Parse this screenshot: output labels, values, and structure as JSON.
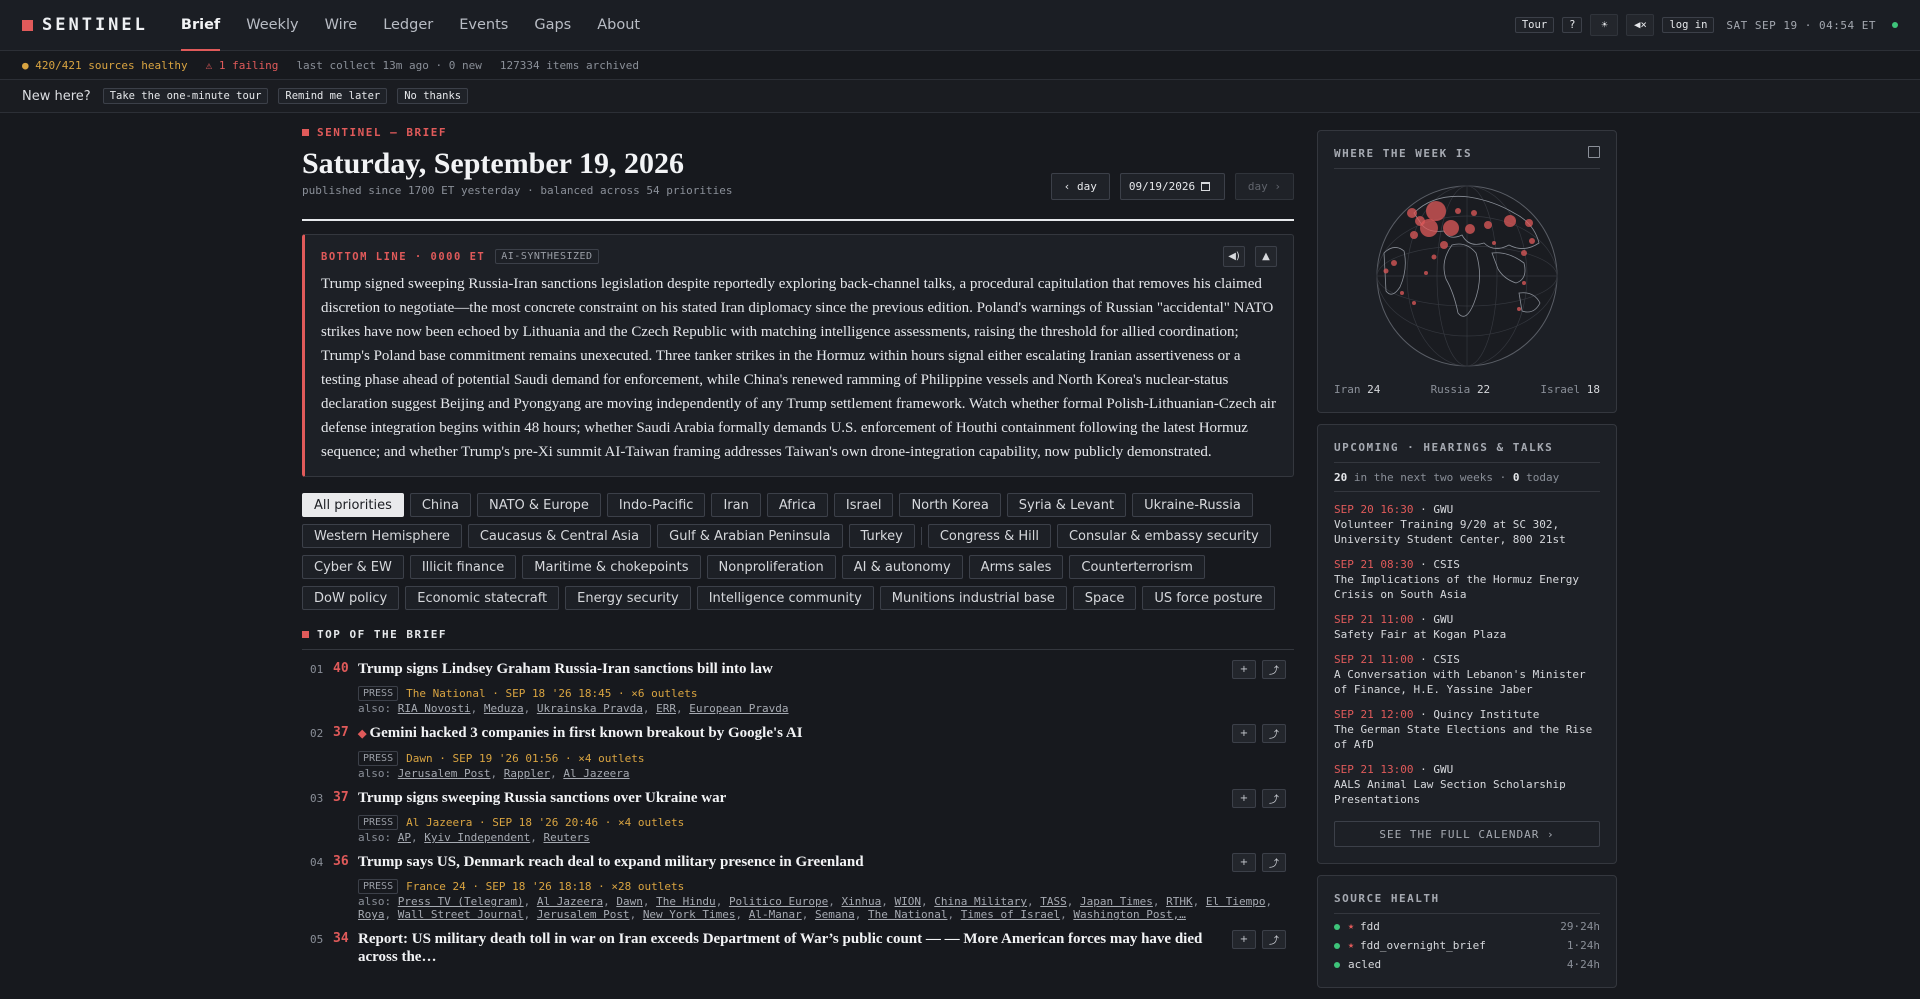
{
  "nav": {
    "brand": "SENTINEL",
    "links": [
      "Brief",
      "Weekly",
      "Wire",
      "Ledger",
      "Events",
      "Gaps",
      "About"
    ],
    "active_index": 0,
    "tour_label": "Tour",
    "help_label": "?",
    "theme_icon": "☀",
    "mute_icon": "◀×",
    "login_label": "log in",
    "clock": "SAT SEP 19 · 04:54 ET"
  },
  "status": {
    "healthy": "● 420/421 sources healthy",
    "failing": "⚠ 1 failing",
    "collect": "last collect 13m ago · 0 new",
    "archived": "127334 items archived"
  },
  "welcome": {
    "question": "New here?",
    "tour": "Take the one-minute tour",
    "later": "Remind me later",
    "no": "No thanks"
  },
  "brief": {
    "kicker": "SENTINEL — BRIEF",
    "title": "Saturday, September 19, 2026",
    "subtitle": "published since 1700 ET yesterday · balanced across 54 priorities",
    "prev_day": "‹ day",
    "date_value": "09/19/2026",
    "next_day": "day ›",
    "bottom_line_label": "BOTTOM LINE · 0000 ET",
    "ai_badge": "AI-SYNTHESIZED",
    "bottom_line": "Trump signed sweeping Russia-Iran sanctions legislation despite reportedly exploring back-channel talks, a procedural capitulation that removes his claimed discretion to negotiate—the most concrete constraint on his stated Iran diplomacy since the previous edition. Poland's warnings of Russian \"accidental\" NATO strikes have now been echoed by Lithuania and the Czech Republic with matching intelligence assessments, raising the threshold for allied coordination; Trump's Poland base commitment remains unexecuted. Three tanker strikes in the Hormuz within hours signal either escalating Iranian assertiveness or a testing phase ahead of potential Saudi demand for enforcement, while China's renewed ramming of Philippine vessels and North Korea's nuclear-status declaration suggest Beijing and Pyongyang are moving independently of any Trump settlement framework. Watch whether formal Polish-Lithuanian-Czech air defense integration begins within 48 hours; whether Saudi Arabia formally demands U.S. enforcement of Houthi containment following the latest Hormuz sequence; and whether Trump's pre-Xi summit AI-Taiwan framing addresses Taiwan's own drone-integration capability, now publicly demonstrated."
  },
  "chips_row1": [
    "All priorities",
    "China",
    "NATO & Europe",
    "Indo-Pacific",
    "Iran",
    "Africa",
    "Israel",
    "North Korea",
    "Syria & Levant",
    "Ukraine-Russia"
  ],
  "chips_row2a": [
    "Western Hemisphere",
    "Caucasus & Central Asia",
    "Gulf & Arabian Peninsula",
    "Turkey"
  ],
  "chips_row2b": [
    "Congress & Hill",
    "Consular & embassy security"
  ],
  "chips_row3": [
    "Cyber & EW",
    "Illicit finance",
    "Maritime & chokepoints",
    "Nonproliferation",
    "AI & autonomy",
    "Arms sales",
    "Counterterrorism"
  ],
  "chips_row4": [
    "DoW policy",
    "Economic statecraft",
    "Energy security",
    "Intelligence community",
    "Munitions industrial base",
    "Space",
    "US force posture"
  ],
  "top_head": "TOP OF THE BRIEF",
  "stories": [
    {
      "idx": "01",
      "score": "40",
      "flag": "",
      "title": "Trump signs Lindsey Graham Russia-Iran sanctions bill into law",
      "press": "PRESS",
      "meta": "The National · SEP 18 '26 18:45 · ×6 outlets",
      "also": [
        "RIA Novosti",
        "Meduza",
        "Ukrainska Pravda",
        "ERR",
        "European Pravda"
      ]
    },
    {
      "idx": "02",
      "score": "37",
      "flag": "◆",
      "title": "Gemini hacked 3 companies in first known breakout by Google's AI",
      "press": "PRESS",
      "meta": "Dawn · SEP 19 '26 01:56 · ×4 outlets",
      "also": [
        "Jerusalem Post",
        "Rappler",
        "Al Jazeera"
      ]
    },
    {
      "idx": "03",
      "score": "37",
      "flag": "",
      "title": "Trump signs sweeping Russia sanctions over Ukraine war",
      "press": "PRESS",
      "meta": "Al Jazeera · SEP 18 '26 20:46 · ×4 outlets",
      "also": [
        "AP",
        "Kyiv Independent",
        "Reuters"
      ]
    },
    {
      "idx": "04",
      "score": "36",
      "flag": "",
      "title": "Trump says US, Denmark reach deal to expand military presence in Greenland",
      "press": "PRESS",
      "meta": "France 24 · SEP 18 '26 18:18 · ×28 outlets",
      "also": [
        "Press TV (Telegram)",
        "Al Jazeera",
        "Dawn",
        "The Hindu",
        "Politico Europe",
        "Xinhua",
        "WION",
        "China Military",
        "TASS",
        "Japan Times",
        "RTHK",
        "El Tiempo",
        "Roya",
        "Wall Street Journal",
        "Jerusalem Post",
        "New York Times",
        "Al-Manar",
        "Semana",
        "The National",
        "Times of Israel",
        "Washington Post,…"
      ]
    },
    {
      "idx": "05",
      "score": "34",
      "flag": "",
      "title": "Report: US military death toll in war on Iran exceeds Department of War’s public count — — More American forces may have died across the…",
      "press": "",
      "meta": "",
      "also": []
    }
  ],
  "globe": {
    "title": "WHERE THE WEEK IS",
    "legend": [
      {
        "name": "Iran",
        "count": "24"
      },
      {
        "name": "Russia",
        "count": "22"
      },
      {
        "name": "Israel",
        "count": "18"
      }
    ]
  },
  "upcoming": {
    "title": "UPCOMING · HEARINGS & TALKS",
    "count": "20",
    "period": "in the next two weeks ·",
    "today": "0",
    "today_label": "today",
    "events": [
      {
        "when": "SEP 20 16:30",
        "org": "GWU",
        "title": "Volunteer Training 9/20 at SC 302, University Student Center, 800 21st"
      },
      {
        "when": "SEP 21 08:30",
        "org": "CSIS",
        "title": "The Implications of the Hormuz Energy Crisis on South Asia"
      },
      {
        "when": "SEP 21 11:00",
        "org": "GWU",
        "title": "Safety Fair at Kogan Plaza"
      },
      {
        "when": "SEP 21 11:00",
        "org": "CSIS",
        "title": "A Conversation with Lebanon's Minister of Finance, H.E. Yassine Jaber"
      },
      {
        "when": "SEP 21 12:00",
        "org": "Quincy Institute",
        "title": "The German State Elections and the Rise of AfD"
      },
      {
        "when": "SEP 21 13:00",
        "org": "GWU",
        "title": "AALS Animal Law Section Scholarship Presentations"
      }
    ],
    "calendar_btn": "SEE THE FULL CALENDAR ›"
  },
  "health": {
    "title": "SOURCE HEALTH",
    "sources": [
      {
        "name": "fdd",
        "star": "★",
        "count": "29·24h"
      },
      {
        "name": "fdd_overnight_brief",
        "star": "★",
        "count": "1·24h"
      },
      {
        "name": "acled",
        "star": "",
        "count": "4·24h"
      }
    ]
  },
  "colors": {
    "accent": "#e05a5a",
    "amber": "#d9a441",
    "ok": "#3ec47a",
    "bg": "#17191e"
  }
}
